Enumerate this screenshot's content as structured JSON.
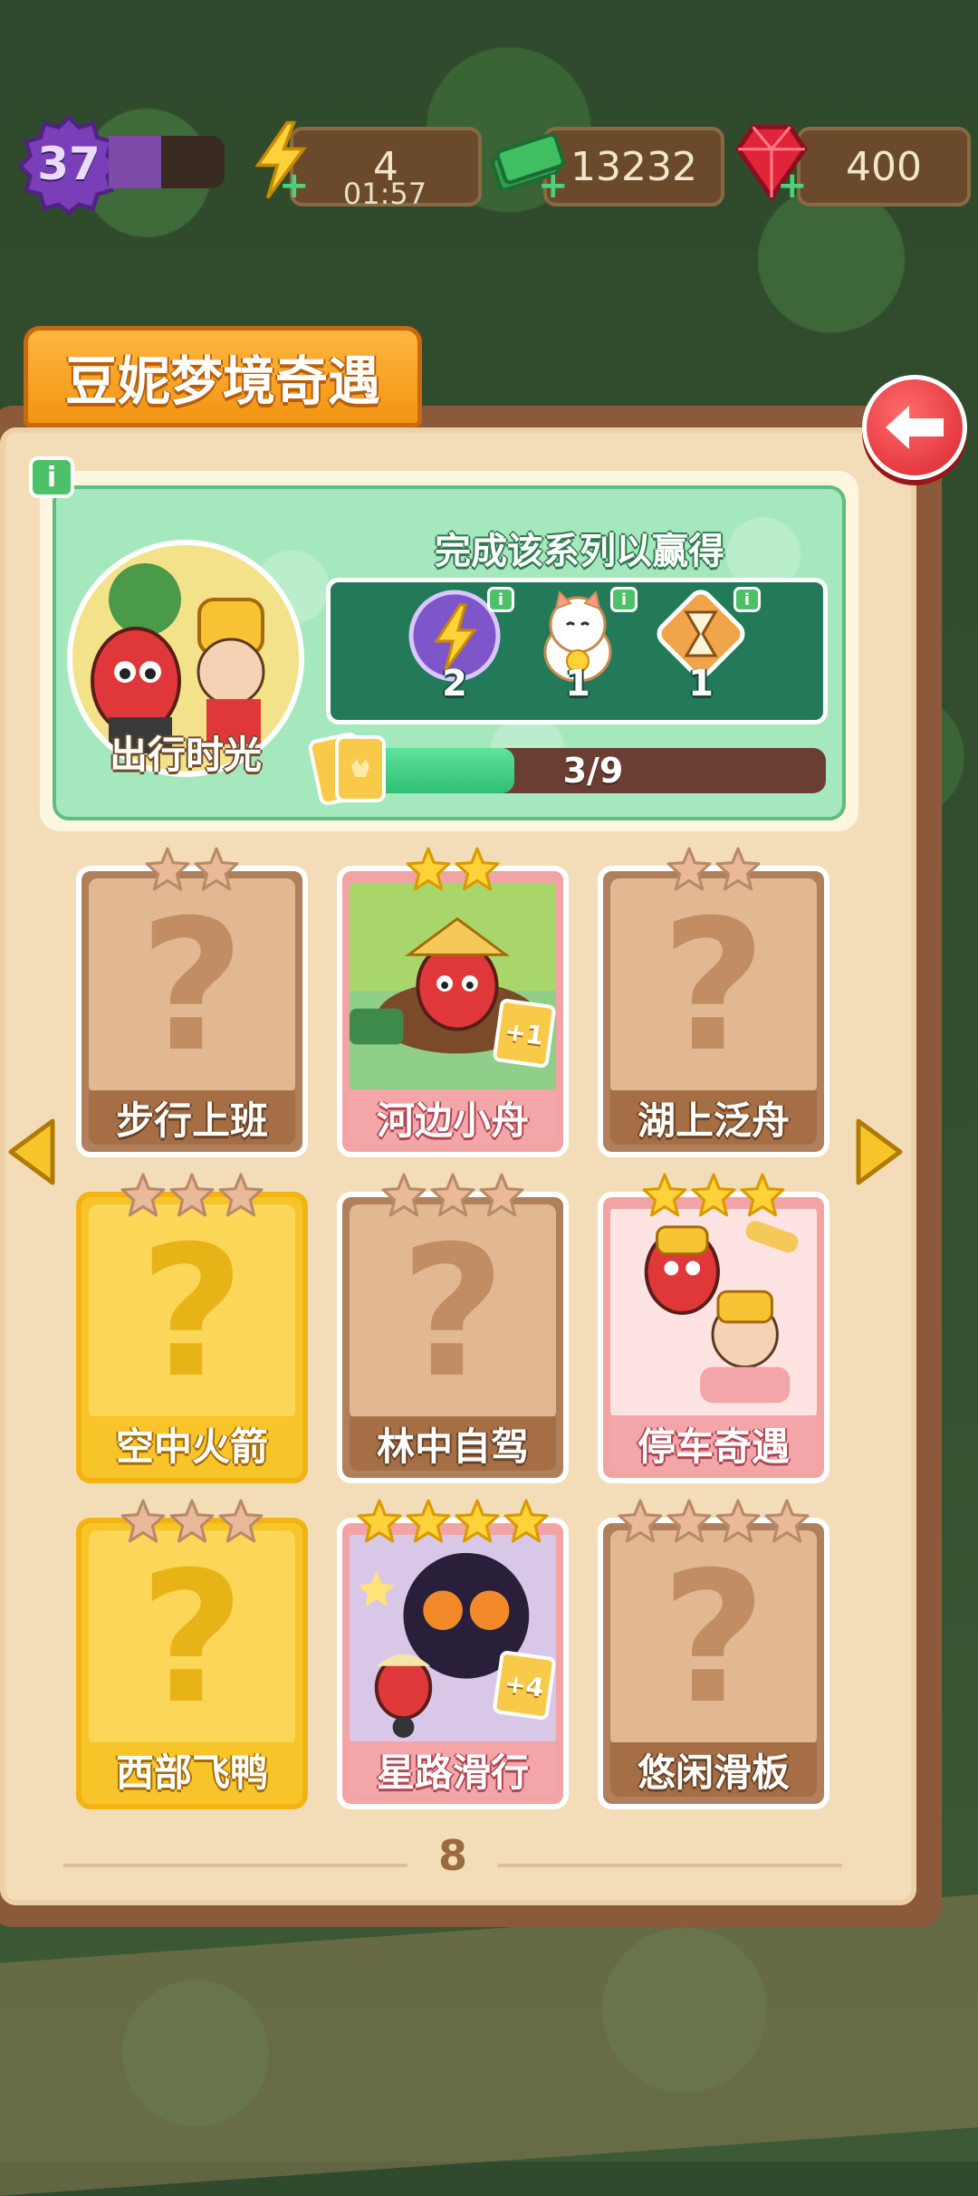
{
  "hud": {
    "level": "37",
    "level_progress": 0.45,
    "energy": "4",
    "energy_timer": "01:57",
    "cash": "13232",
    "gems": "400"
  },
  "title": "豆妮梦境奇遇",
  "series": {
    "name": "出行时光",
    "reward_title": "完成该系列以赢得",
    "rewards": [
      {
        "icon": "lightning-orb-icon",
        "count": "2"
      },
      {
        "icon": "lucky-cat-icon",
        "count": "1"
      },
      {
        "icon": "hourglass-icon",
        "count": "1"
      }
    ],
    "progress_text": "3/9",
    "progress_value": 0.33
  },
  "cards": [
    {
      "label": "步行上班",
      "state": "locked",
      "stars": 2
    },
    {
      "label": "河边小舟",
      "state": "owned",
      "stars": 2,
      "extra": "+1"
    },
    {
      "label": "湖上泛舟",
      "state": "locked",
      "stars": 2
    },
    {
      "label": "空中火箭",
      "state": "gold",
      "stars": 3
    },
    {
      "label": "林中自驾",
      "state": "locked",
      "stars": 3
    },
    {
      "label": "停车奇遇",
      "state": "owned",
      "stars": 3
    },
    {
      "label": "西部飞鸭",
      "state": "gold",
      "stars": 3
    },
    {
      "label": "星路滑行",
      "state": "owned",
      "stars": 4,
      "extra": "+4"
    },
    {
      "label": "悠闲滑板",
      "state": "locked",
      "stars": 4
    }
  ],
  "page_number": "8",
  "colors": {
    "accent_orange": "#f29412",
    "green_panel": "#a6e8bd",
    "reward_box": "#227a59",
    "progress_fill": "#2fbf74",
    "back_button": "#d9262f"
  }
}
